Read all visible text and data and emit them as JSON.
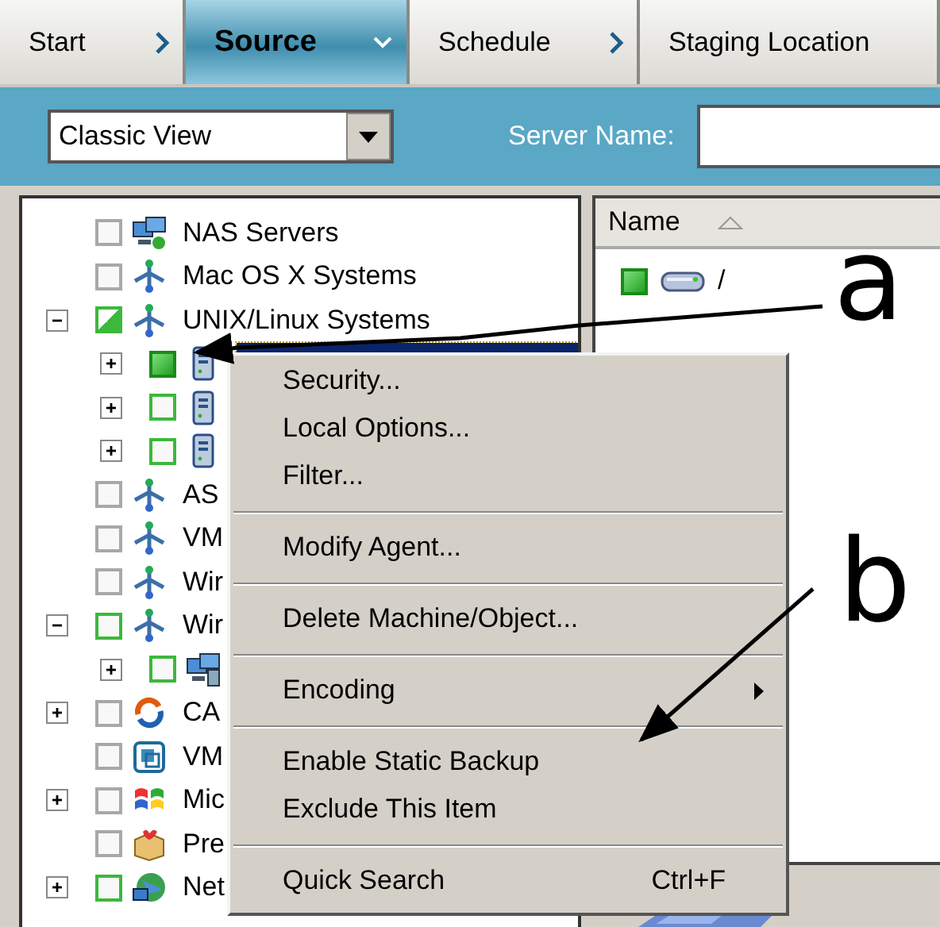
{
  "tabs": [
    {
      "label": "Start",
      "selected": false,
      "chevron": true
    },
    {
      "label": "Source",
      "selected": true,
      "chevron": true
    },
    {
      "label": "Schedule",
      "selected": false,
      "chevron": true
    },
    {
      "label": "Staging Location",
      "selected": false,
      "chevron": false
    }
  ],
  "toolbar": {
    "view_select": {
      "value": "Classic View"
    },
    "server_name": {
      "label": "Server Name:"
    }
  },
  "tree": [
    {
      "label": "NAS Servers",
      "kind": "nas",
      "color": "#a8a8a8",
      "checked": false,
      "partial": false
    },
    {
      "label": "Mac OS X Systems",
      "kind": "network",
      "color": "#a8a8a8",
      "checked": false,
      "partial": false
    },
    {
      "label": "UNIX/Linux Systems",
      "kind": "network",
      "color": "#3cb83c",
      "checked": true,
      "partial": true,
      "expanded": true,
      "children": [
        {
          "kind": "server",
          "color": "#1a8a1a",
          "checked": true,
          "partial": false,
          "expanded": false,
          "selected": true
        },
        {
          "kind": "server",
          "color": "#3cb83c",
          "checked": false,
          "partial": false,
          "expanded": false,
          "selected": false
        },
        {
          "kind": "server",
          "color": "#3cb83c",
          "checked": false,
          "partial": false,
          "expanded": false,
          "selected": false
        }
      ]
    },
    {
      "label": "AS",
      "kind": "network",
      "color": "#a8a8a8",
      "checked": false,
      "partial": false
    },
    {
      "label": "VM",
      "kind": "network",
      "color": "#a8a8a8",
      "checked": false,
      "partial": false
    },
    {
      "label": "Wir",
      "kind": "network",
      "color": "#a8a8a8",
      "checked": false,
      "partial": false
    },
    {
      "label": "Wir",
      "kind": "network",
      "color": "#3cb83c",
      "checked": false,
      "partial": false,
      "expanded": true,
      "children": [
        {
          "kind": "workstation",
          "color": "#3cb83c",
          "checked": false,
          "partial": false,
          "expanded": false,
          "selected": false
        }
      ]
    },
    {
      "label": "CA",
      "kind": "sync",
      "color": "#a8a8a8",
      "checked": false,
      "partial": false,
      "expanded": false
    },
    {
      "label": "VM",
      "kind": "vm",
      "color": "#a8a8a8",
      "checked": false,
      "partial": false
    },
    {
      "label": "Mic",
      "kind": "windows",
      "color": "#a8a8a8",
      "checked": false,
      "partial": false,
      "expanded": false
    },
    {
      "label": "Pre",
      "kind": "package",
      "color": "#a8a8a8",
      "checked": false,
      "partial": false
    },
    {
      "label": "Net",
      "kind": "globe",
      "color": "#3cb83c",
      "checked": false,
      "partial": false,
      "expanded": false
    }
  ],
  "context_menu": [
    {
      "kind": "item",
      "label": "Security..."
    },
    {
      "kind": "item",
      "label": "Local Options..."
    },
    {
      "kind": "item",
      "label": "Filter..."
    },
    {
      "kind": "separator"
    },
    {
      "kind": "item",
      "label": "Modify Agent..."
    },
    {
      "kind": "separator"
    },
    {
      "kind": "item",
      "label": "Delete Machine/Object..."
    },
    {
      "kind": "separator"
    },
    {
      "kind": "submenu",
      "label": "Encoding"
    },
    {
      "kind": "separator"
    },
    {
      "kind": "item",
      "label": "Enable Static Backup"
    },
    {
      "kind": "item",
      "label": "Exclude This Item"
    },
    {
      "kind": "separator"
    },
    {
      "kind": "item",
      "label": "Quick Search",
      "shortcut": "Ctrl+F"
    }
  ],
  "details": {
    "columns": [
      {
        "label": "Name",
        "sort_ascending": true
      }
    ],
    "rows": [
      {
        "name": "/",
        "color": "#1a8a1a",
        "checked": true,
        "partial": false
      }
    ]
  },
  "annotations": [
    {
      "label": "a"
    },
    {
      "label": "b"
    }
  ]
}
